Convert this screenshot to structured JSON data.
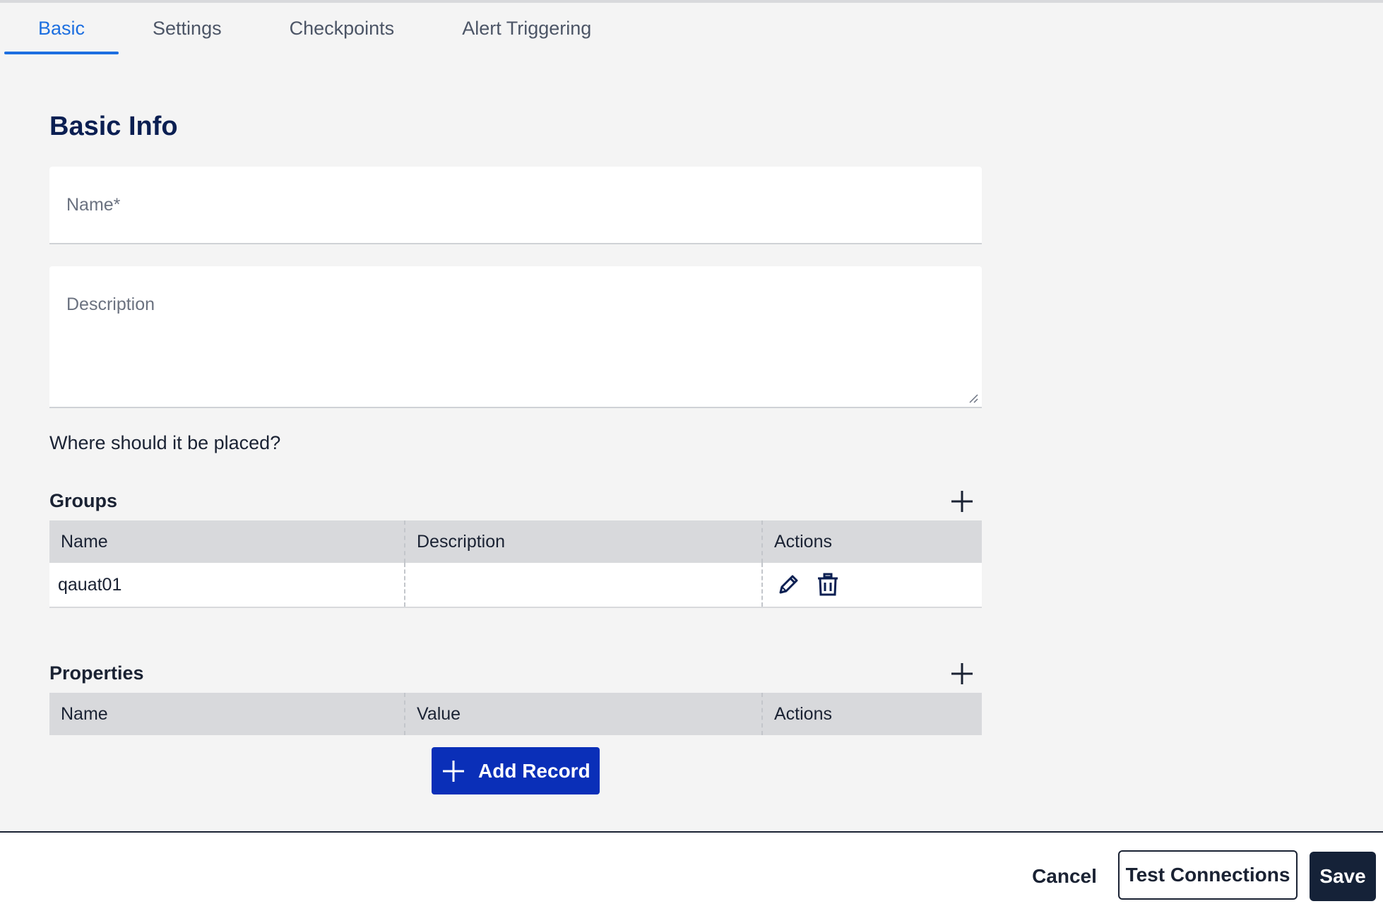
{
  "tabs": [
    {
      "label": "Basic",
      "active": true
    },
    {
      "label": "Settings",
      "active": false
    },
    {
      "label": "Checkpoints",
      "active": false
    },
    {
      "label": "Alert Triggering",
      "active": false
    }
  ],
  "basic_info": {
    "title": "Basic Info",
    "name_placeholder": "Name*",
    "description_placeholder": "Description",
    "placement_question": "Where should it be placed?"
  },
  "groups": {
    "title": "Groups",
    "columns": [
      "Name",
      "Description",
      "Actions"
    ],
    "rows": [
      {
        "name": "qauat01",
        "description": ""
      }
    ]
  },
  "properties": {
    "title": "Properties",
    "columns": [
      "Name",
      "Value",
      "Actions"
    ],
    "add_record_label": "Add Record"
  },
  "footer": {
    "cancel_label": "Cancel",
    "test_label": "Test Connections",
    "save_label": "Save"
  },
  "colors": {
    "accent": "#1d6fe0",
    "primary_button": "#0a2fb8",
    "heading": "#0b1f52",
    "save_button": "#152238"
  },
  "icons": [
    "plus-icon",
    "pencil-icon",
    "trash-icon",
    "resize-handle-icon"
  ]
}
